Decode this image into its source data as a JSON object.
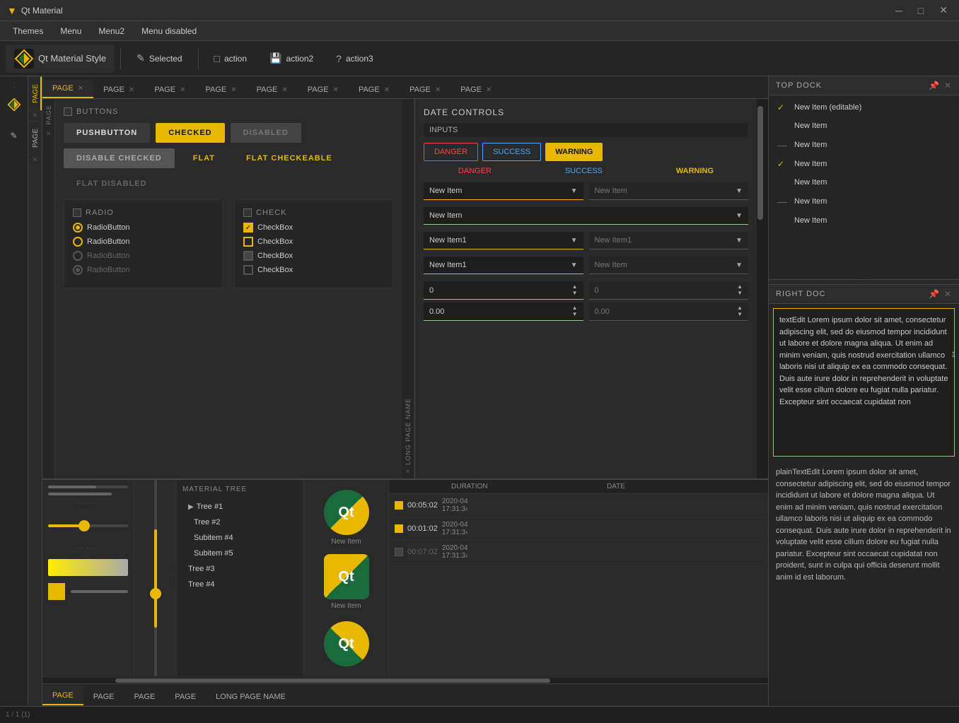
{
  "titleBar": {
    "title": "Qt Material",
    "icon": "▼",
    "controls": [
      "─",
      "□",
      "✕"
    ]
  },
  "menuBar": {
    "items": [
      "Themes",
      "Menu",
      "Menu2",
      "Menu disabled"
    ]
  },
  "toolbar": {
    "logo": {
      "text": "Qt Material Style"
    },
    "actions": [
      {
        "icon": "✎",
        "label": "Selected",
        "id": "selected"
      },
      {
        "icon": "□",
        "label": "action",
        "id": "action"
      },
      {
        "icon": "💾",
        "label": "action2",
        "id": "action2"
      },
      {
        "icon": "?",
        "label": "action3",
        "id": "action3"
      }
    ]
  },
  "leftTabs": {
    "items": [
      {
        "label": "PAGE",
        "active": true
      },
      {
        "label": "PAGE",
        "active": false
      },
      {
        "label": "LONG PAGE NAME",
        "active": false
      }
    ]
  },
  "buttons": {
    "sectionTitle": "BUTTONS",
    "items": [
      {
        "label": "PUSHBUTTON",
        "style": "default"
      },
      {
        "label": "CHECKED",
        "style": "checked"
      },
      {
        "label": "DISABLED",
        "style": "disabled"
      }
    ],
    "row2": [
      {
        "label": "DISABLE CHECKED",
        "style": "disable-checked"
      },
      {
        "label": "FLAT",
        "style": "flat"
      },
      {
        "label": "FLAT CHECKEABLE",
        "style": "flat-check"
      }
    ],
    "row3": [
      {
        "label": "FLAT DISABLED",
        "style": "flat-disabled"
      }
    ]
  },
  "radio": {
    "sectionTitle": "RADIO",
    "items": [
      {
        "label": "RadioButton",
        "checked": true,
        "disabled": false
      },
      {
        "label": "RadioButton",
        "checked": false,
        "disabled": false
      },
      {
        "label": "RadioButton",
        "checked": false,
        "disabled": true
      },
      {
        "label": "RadioButton",
        "checked": false,
        "disabled": true
      }
    ]
  },
  "check": {
    "sectionTitle": "CHECK",
    "items": [
      {
        "label": "CheckBox",
        "checked": true,
        "disabled": false
      },
      {
        "label": "CheckBox",
        "checked": false,
        "disabled": false
      },
      {
        "label": "CheckBox",
        "checked": false,
        "disabled": true
      },
      {
        "label": "CheckBox",
        "checked": false,
        "disabled": true
      }
    ]
  },
  "dateControls": {
    "title": "DATE CONTROLS",
    "inputsLabel": "INPUTS",
    "buttons": {
      "danger": "DANGER",
      "success": "SUCCESS",
      "warning": "WARNING"
    },
    "textRow": {
      "danger": "DANGER",
      "success": "SUCCESS",
      "warning": "WARNING"
    },
    "combos": [
      {
        "value": "New Item",
        "placeholder": "New Item",
        "disabled": false
      },
      {
        "value": "New Item",
        "placeholder": "",
        "disabled": false
      },
      {
        "value": "New Item1",
        "placeholder": "New Item1",
        "disabled": false
      },
      {
        "value": "New Item1",
        "placeholder": "New Item",
        "disabled": false
      }
    ],
    "spinboxes": [
      {
        "value": "0",
        "placeholder": "0",
        "disabled": false
      },
      {
        "value": "0.00",
        "placeholder": "0.00",
        "disabled": false
      }
    ]
  },
  "topDock": {
    "title": "TOP DOCK",
    "items": [
      {
        "label": "New Item (editable)",
        "check": true
      },
      {
        "label": "New Item",
        "check": false,
        "dash": false
      },
      {
        "label": "New Item",
        "check": false,
        "dash": true
      },
      {
        "label": "New Item",
        "check": true
      },
      {
        "label": "New Item",
        "check": false
      },
      {
        "label": "New Item",
        "check": false,
        "dash": true
      },
      {
        "label": "New Item",
        "check": false
      }
    ]
  },
  "rightDock": {
    "title": "RIGHT DOC",
    "textEditContent": "textEdit Lorem ipsum dolor sit amet, consectetur adipiscing elit, sed do eiusmod tempor incididunt ut labore et dolore magna aliqua. Ut enim ad minim veniam, quis nostrud exercitation ullamco laboris nisi ut aliquip ex ea commodo consequat. Duis aute irure dolor in reprehenderit in voluptate velit esse cillum dolore eu fugiat nulla pariatur. Excepteur sint occaecat cupidatat non",
    "plainTextContent": "plainTextEdit\nLorem ipsum dolor sit amet, consectetur adipiscing elit, sed do eiusmod tempor incididunt ut labore et dolore magna aliqua. Ut enim ad minim veniam, quis nostrud exercitation ullamco laboris nisi ut aliquip ex ea commodo consequat. Duis aute irure dolor in reprehenderit in voluptate velit esse cillum dolore eu fugiat nulla pariatur. Excepteur sint occaecat cupidatat non proident, sunt in culpa qui officia deserunt mollit anim id est laborum."
  },
  "tabs": {
    "top": [
      {
        "label": "PAGE",
        "active": true
      },
      {
        "label": "PAGE",
        "active": false
      },
      {
        "label": "PAGE",
        "active": false
      },
      {
        "label": "PAGE",
        "active": false
      },
      {
        "label": "PAGE",
        "active": false
      },
      {
        "label": "PAGE",
        "active": false
      },
      {
        "label": "PAGE",
        "active": false
      },
      {
        "label": "PAGE",
        "active": false
      },
      {
        "label": "PAGE",
        "active": false
      }
    ],
    "bottom": [
      {
        "label": "PAGE",
        "active": true
      },
      {
        "label": "PAGE",
        "active": false
      },
      {
        "label": "PAGE",
        "active": false
      },
      {
        "label": "PAGE",
        "active": false
      },
      {
        "label": "LONG PAGE NAME",
        "active": false
      }
    ]
  },
  "bottomPages": {
    "sliders": {
      "progress1": 60,
      "progress2": 80
    },
    "tree": {
      "title": "MATERIAL TREE",
      "items": [
        {
          "label": "Tree #1",
          "level": 0,
          "expanded": true
        },
        {
          "label": "Tree #2",
          "level": 1
        },
        {
          "label": "Subitem #4",
          "level": 1
        },
        {
          "label": "Subitem #5",
          "level": 1
        },
        {
          "label": "Tree #3",
          "level": 0
        },
        {
          "label": "Tree #4",
          "level": 0
        }
      ]
    },
    "icons": [
      {
        "label": "New Item"
      },
      {
        "label": "New Item"
      }
    ],
    "duration": {
      "headers": [
        "DURATION",
        "DATE"
      ],
      "rows": [
        {
          "checked": true,
          "duration": "00:05:02",
          "date": "2020-04",
          "time": "17:31:3‹"
        },
        {
          "checked": true,
          "duration": "00:01:02",
          "date": "2020-04",
          "time": "17:31:3‹"
        },
        {
          "checked": false,
          "duration": "00:07:02",
          "date": "2020-04",
          "time": "17:31:3‹"
        }
      ]
    }
  }
}
